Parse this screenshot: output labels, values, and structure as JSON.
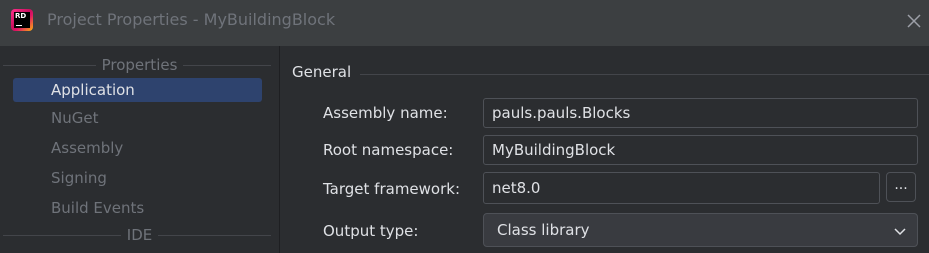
{
  "window": {
    "title": "Project Properties - MyBuildingBlock",
    "app_icon_text": "RD"
  },
  "sidebar": {
    "sections": [
      {
        "header": "Properties",
        "items": [
          {
            "label": "Application",
            "selected": true
          },
          {
            "label": "NuGet"
          },
          {
            "label": "Assembly"
          },
          {
            "label": "Signing"
          },
          {
            "label": "Build Events"
          }
        ]
      },
      {
        "header": "IDE",
        "items": []
      }
    ]
  },
  "main": {
    "group_title": "General",
    "fields": {
      "assembly_name": {
        "label": "Assembly name:",
        "value": "pauls.pauls.Blocks"
      },
      "root_namespace": {
        "label": "Root namespace:",
        "value": "MyBuildingBlock"
      },
      "target_framework": {
        "label": "Target framework:",
        "value": "net8.0",
        "browse_label": "..."
      },
      "output_type": {
        "label": "Output type:",
        "value": "Class library"
      }
    }
  },
  "colors": {
    "background": "#2b2d30",
    "titlebar": "#3c3f41",
    "selection": "#2e436e",
    "text": "#dfe1e5",
    "muted_text": "#6f737a",
    "border": "#4e5157"
  }
}
